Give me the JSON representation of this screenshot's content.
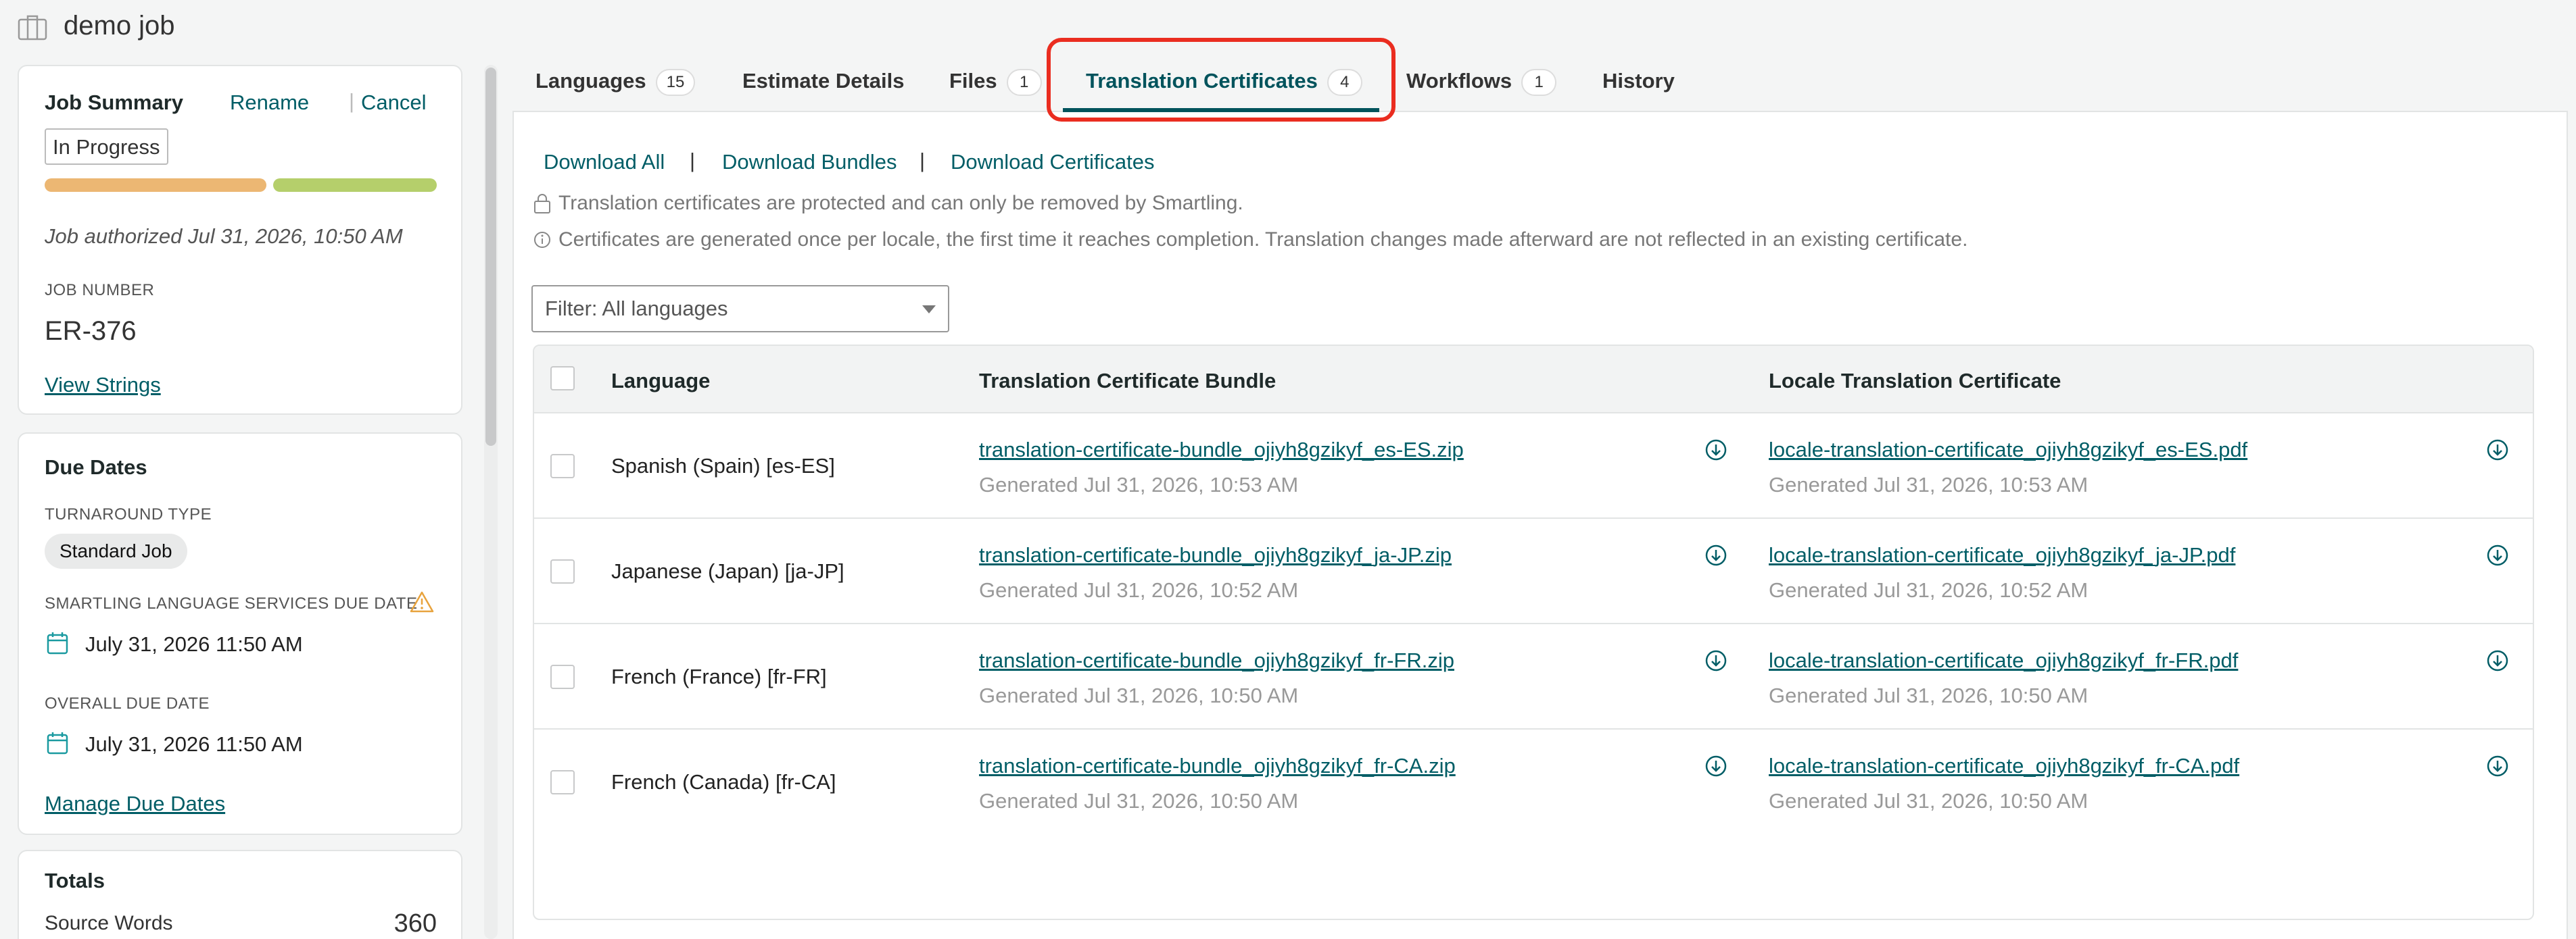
{
  "header": {
    "title": "demo job"
  },
  "summary": {
    "title": "Job Summary",
    "rename": "Rename",
    "separator": "|",
    "cancel": "Cancel",
    "status": "In Progress",
    "progress": {
      "orange_fraction": 0.55,
      "green_fraction": 0.45
    },
    "authorized": "Job authorized Jul 31, 2026, 10:50 AM",
    "job_number_label": "JOB NUMBER",
    "job_number": "ER-376",
    "view_strings": "View Strings"
  },
  "due_dates": {
    "title": "Due Dates",
    "turnaround_label": "TURNAROUND TYPE",
    "turnaround_value": "Standard Job",
    "sls_label": "SMARTLING LANGUAGE SERVICES DUE DATE",
    "sls_date": "July 31, 2026 11:50 AM",
    "overall_label": "OVERALL DUE DATE",
    "overall_date": "July 31, 2026 11:50 AM",
    "manage": "Manage Due Dates"
  },
  "totals": {
    "title": "Totals",
    "source_words_label": "Source Words",
    "source_words": "360"
  },
  "tabs": [
    {
      "label": "Languages",
      "count": "15"
    },
    {
      "label": "Estimate Details",
      "count": ""
    },
    {
      "label": "Files",
      "count": "1"
    },
    {
      "label": "Translation Certificates",
      "count": "4"
    },
    {
      "label": "Workflows",
      "count": "1"
    },
    {
      "label": "History",
      "count": ""
    }
  ],
  "actions": {
    "download_all": "Download All",
    "download_bundles": "Download Bundles",
    "download_certificates": "Download Certificates",
    "separator": "|"
  },
  "info": {
    "protected": "Translation certificates are protected and can only be removed by Smartling.",
    "generated": "Certificates are generated once per locale, the first time it reaches completion. Translation changes made afterward are not reflected in an existing certificate."
  },
  "filter": {
    "label": "Filter: All languages"
  },
  "table": {
    "headers": {
      "language": "Language",
      "bundle": "Translation Certificate Bundle",
      "locale": "Locale Translation Certificate"
    },
    "rows": [
      {
        "language": "Spanish (Spain) [es-ES]",
        "bundle_file": "translation-certificate-bundle_ojiyh8gzikyf_es-ES.zip",
        "bundle_generated": "Generated Jul 31, 2026, 10:53 AM",
        "locale_file": "locale-translation-certificate_ojiyh8gzikyf_es-ES.pdf",
        "locale_generated": "Generated Jul 31, 2026, 10:53 AM"
      },
      {
        "language": "Japanese (Japan) [ja-JP]",
        "bundle_file": "translation-certificate-bundle_ojiyh8gzikyf_ja-JP.zip",
        "bundle_generated": "Generated Jul 31, 2026, 10:52 AM",
        "locale_file": "locale-translation-certificate_ojiyh8gzikyf_ja-JP.pdf",
        "locale_generated": "Generated Jul 31, 2026, 10:52 AM"
      },
      {
        "language": "French (France) [fr-FR]",
        "bundle_file": "translation-certificate-bundle_ojiyh8gzikyf_fr-FR.zip",
        "bundle_generated": "Generated Jul 31, 2026, 10:50 AM",
        "locale_file": "locale-translation-certificate_ojiyh8gzikyf_fr-FR.pdf",
        "locale_generated": "Generated Jul 31, 2026, 10:50 AM"
      },
      {
        "language": "French (Canada) [fr-CA]",
        "bundle_file": "translation-certificate-bundle_ojiyh8gzikyf_fr-CA.zip",
        "bundle_generated": "Generated Jul 31, 2026, 10:50 AM",
        "locale_file": "locale-translation-certificate_ojiyh8gzikyf_fr-CA.pdf",
        "locale_generated": "Generated Jul 31, 2026, 10:50 AM"
      }
    ]
  },
  "colors": {
    "accent": "#005d66",
    "highlight": "#ea2d20",
    "progress_orange": "#ecb773",
    "progress_green": "#b5cf6b"
  }
}
